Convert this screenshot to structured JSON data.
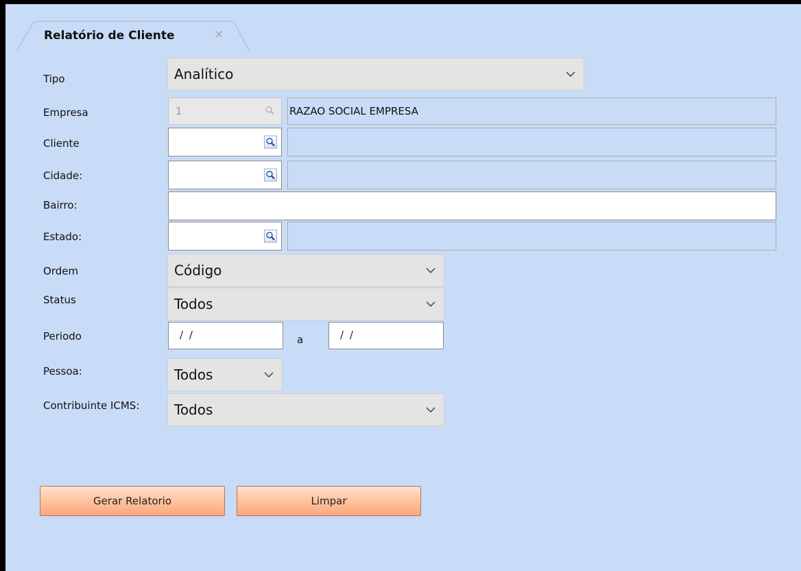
{
  "tab": {
    "title": "Relatório de Cliente",
    "close_glyph": "✕"
  },
  "fields": {
    "tipo": {
      "label": "Tipo",
      "value": "Analítico"
    },
    "empresa": {
      "label": "Empresa",
      "code": "1",
      "description": "RAZAO SOCIAL EMPRESA"
    },
    "cliente": {
      "label": "Cliente",
      "code": "",
      "description": ""
    },
    "cidade": {
      "label": "Cidade:",
      "code": "",
      "description": ""
    },
    "bairro": {
      "label": "Bairro:",
      "value": ""
    },
    "estado": {
      "label": "Estado:",
      "code": "",
      "description": ""
    },
    "ordem": {
      "label": "Ordem",
      "value": "Código"
    },
    "status": {
      "label": "Status",
      "value": "Todos"
    },
    "periodo": {
      "label": "Periodo",
      "start": "/ /",
      "separator": "a",
      "end": "/ /"
    },
    "pessoa": {
      "label": "Pessoa:",
      "value": "Todos"
    },
    "contribuinte": {
      "label": "Contribuinte ICMS:",
      "value": "Todos"
    }
  },
  "buttons": {
    "generate": "Gerar Relatorio",
    "clear": "Limpar"
  },
  "icons": {
    "lookup": "magnifier-icon",
    "dropdown": "chevron-down-icon",
    "close": "close-icon"
  },
  "colors": {
    "background": "#c9dcf7",
    "button": "#ffc6a2",
    "select": "#e4e4e4"
  }
}
